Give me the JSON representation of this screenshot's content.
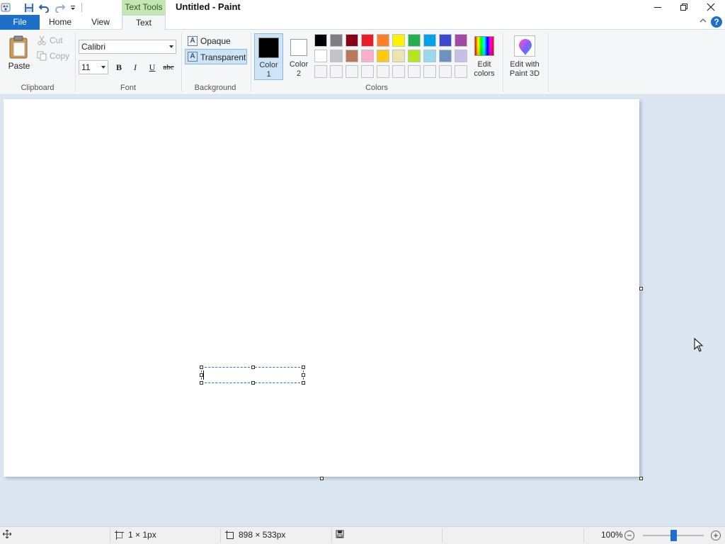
{
  "window": {
    "title": "Untitled - Paint",
    "contextual_tab_group": "Text Tools"
  },
  "tabs": {
    "file": "File",
    "home": "Home",
    "view": "View",
    "text": "Text"
  },
  "clipboard": {
    "paste": "Paste",
    "cut": "Cut",
    "copy": "Copy",
    "label": "Clipboard"
  },
  "font": {
    "name": "Calibri",
    "size": "11",
    "bold": "B",
    "italic": "I",
    "underline": "U",
    "strikethrough": "abc",
    "label": "Font"
  },
  "background": {
    "opaque": "Opaque",
    "transparent": "Transparent",
    "selected": "Transparent",
    "label": "Background"
  },
  "colors": {
    "color1_label_line1": "Color",
    "color1_label_line2": "1",
    "color2_label_line1": "Color",
    "color2_label_line2": "2",
    "color1_value": "#000000",
    "color2_value": "#ffffff",
    "edit_colors_line1": "Edit",
    "edit_colors_line2": "colors",
    "paint3d_line1": "Edit with",
    "paint3d_line2": "Paint 3D",
    "label": "Colors",
    "palette_row1": [
      "#000000",
      "#7f7f7f",
      "#880015",
      "#ed1c24",
      "#ff7f27",
      "#fff200",
      "#22b14c",
      "#00a2e8",
      "#3f48cc",
      "#a349a4"
    ],
    "palette_row2": [
      "#ffffff",
      "#c3c3c3",
      "#b97a57",
      "#ffaec9",
      "#ffc90e",
      "#efe4b0",
      "#b5e61d",
      "#99d9ea",
      "#7092be",
      "#c8bfe7"
    ],
    "palette_row3": [
      "#f5f5f5",
      "#f5f5f5",
      "#f5f5f5",
      "#f5f5f5",
      "#f5f5f5",
      "#f5f5f5",
      "#f5f5f5",
      "#f5f5f5",
      "#f5f5f5",
      "#f5f5f5"
    ]
  },
  "status": {
    "selection_size": "1 × 1px",
    "canvas_size": "898 × 533px",
    "zoom": "100%",
    "zoom_fraction": 0.5
  }
}
